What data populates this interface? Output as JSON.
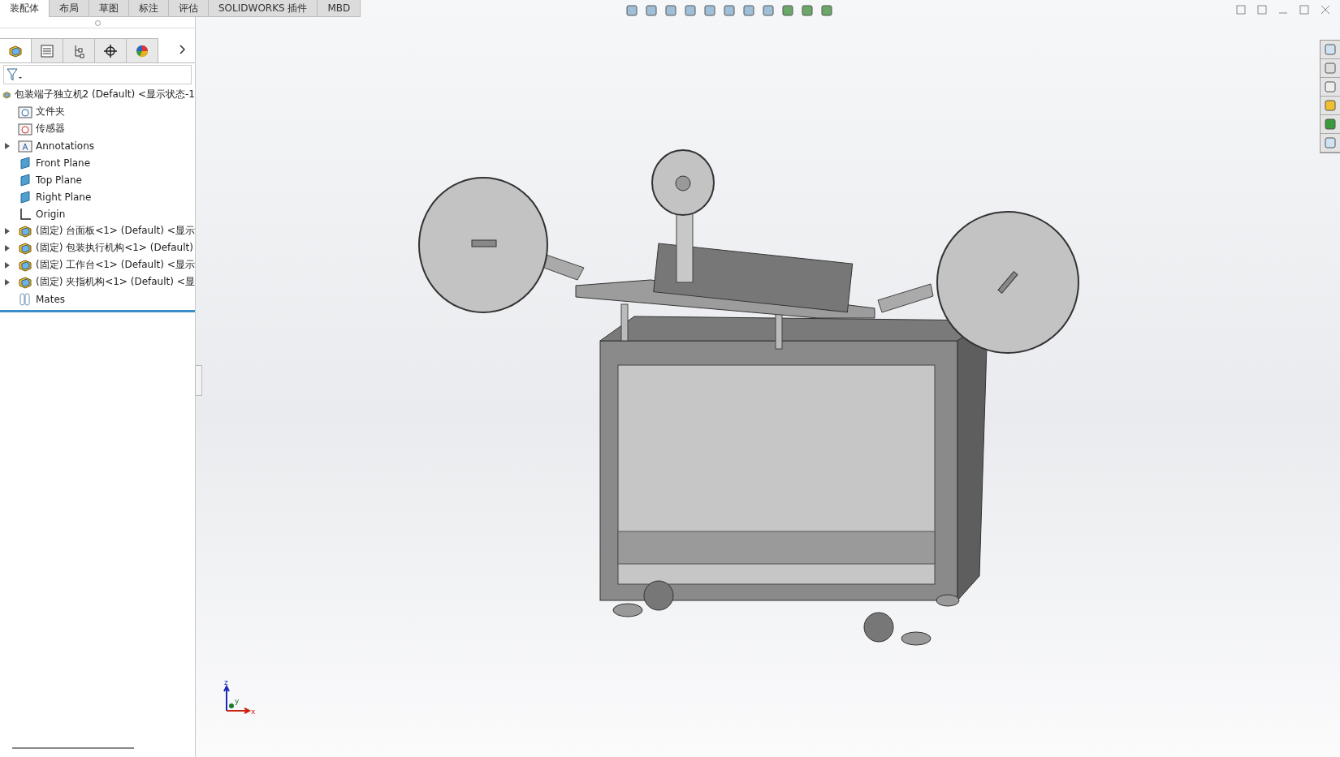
{
  "command_tabs": [
    {
      "label": "装配体",
      "selected": true
    },
    {
      "label": "布局",
      "selected": false
    },
    {
      "label": "草图",
      "selected": false
    },
    {
      "label": "标注",
      "selected": false
    },
    {
      "label": "评估",
      "selected": false
    },
    {
      "label": "SOLIDWORKS 插件",
      "selected": false
    },
    {
      "label": "MBD",
      "selected": false
    }
  ],
  "panel_tabs": [
    {
      "kind": "feature",
      "selected": true
    },
    {
      "kind": "property",
      "selected": false
    },
    {
      "kind": "config",
      "selected": false
    },
    {
      "kind": "dim",
      "selected": false
    },
    {
      "kind": "display",
      "selected": false
    }
  ],
  "tree": {
    "label": "包装端子独立机2 (Default) <显示状态-1",
    "kind": "assembly",
    "children": [
      {
        "label": "文件夹",
        "kind": "history",
        "collapsed": false
      },
      {
        "label": "传感器",
        "kind": "sensor",
        "collapsed": false
      },
      {
        "label": "Annotations",
        "kind": "annotations",
        "collapsed": true
      },
      {
        "label": "Front Plane",
        "kind": "plane",
        "collapsed": false
      },
      {
        "label": "Top Plane",
        "kind": "plane",
        "collapsed": false
      },
      {
        "label": "Right Plane",
        "kind": "plane",
        "collapsed": false
      },
      {
        "label": "Origin",
        "kind": "origin",
        "collapsed": false
      },
      {
        "label": "(固定) 台面板<1> (Default) <显示",
        "kind": "part",
        "collapsed": true
      },
      {
        "label": "(固定) 包装执行机构<1> (Default)",
        "kind": "part",
        "collapsed": true
      },
      {
        "label": "(固定) 工作台<1> (Default) <显示",
        "kind": "part",
        "collapsed": true
      },
      {
        "label": "(固定) 夹指机构<1> (Default) <显",
        "kind": "part",
        "collapsed": true
      },
      {
        "label": "Mates",
        "kind": "mates",
        "collapsed": false
      }
    ]
  },
  "triad": {
    "z": "z",
    "y": "y",
    "x": "x"
  }
}
